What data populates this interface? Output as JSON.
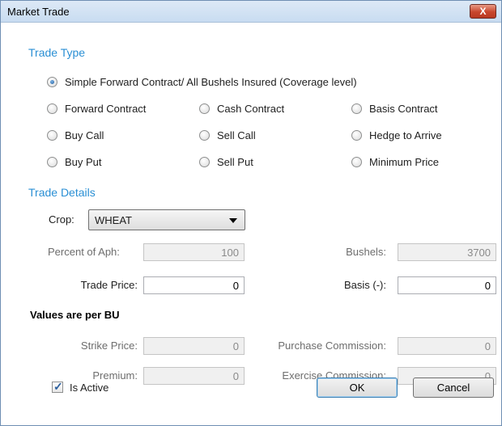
{
  "window": {
    "title": "Market Trade",
    "close_label": "X"
  },
  "trade_type": {
    "section_title": "Trade Type",
    "options": [
      {
        "label": "Simple Forward Contract/ All Bushels Insured (Coverage level)",
        "checked": true
      },
      {
        "label": "Forward Contract",
        "checked": false
      },
      {
        "label": "Cash Contract",
        "checked": false
      },
      {
        "label": "Basis Contract",
        "checked": false
      },
      {
        "label": "Buy Call",
        "checked": false
      },
      {
        "label": "Sell Call",
        "checked": false
      },
      {
        "label": "Hedge to Arrive",
        "checked": false
      },
      {
        "label": "Buy Put",
        "checked": false
      },
      {
        "label": "Sell Put",
        "checked": false
      },
      {
        "label": "Minimum Price",
        "checked": false
      }
    ]
  },
  "trade_details": {
    "section_title": "Trade Details",
    "crop": {
      "label": "Crop:",
      "value": "WHEAT"
    },
    "percent_of_aph": {
      "label": "Percent of Aph:",
      "value": "100"
    },
    "bushels": {
      "label": "Bushels:",
      "value": "3700"
    },
    "trade_price": {
      "label": "Trade Price:",
      "value": "0"
    },
    "basis": {
      "label": "Basis (-):",
      "value": "0"
    }
  },
  "per_bu": {
    "heading": "Values are per BU",
    "strike_price": {
      "label": "Strike Price:",
      "value": "0"
    },
    "purchase_commission": {
      "label": "Purchase Commission:",
      "value": "0"
    },
    "premium": {
      "label": "Premium:",
      "value": "0"
    },
    "exercise_commission": {
      "label": "Exercise Commission:",
      "value": "0"
    }
  },
  "footer": {
    "is_active": {
      "label": "Is Active",
      "checked": true
    },
    "ok_label": "OK",
    "cancel_label": "Cancel"
  }
}
